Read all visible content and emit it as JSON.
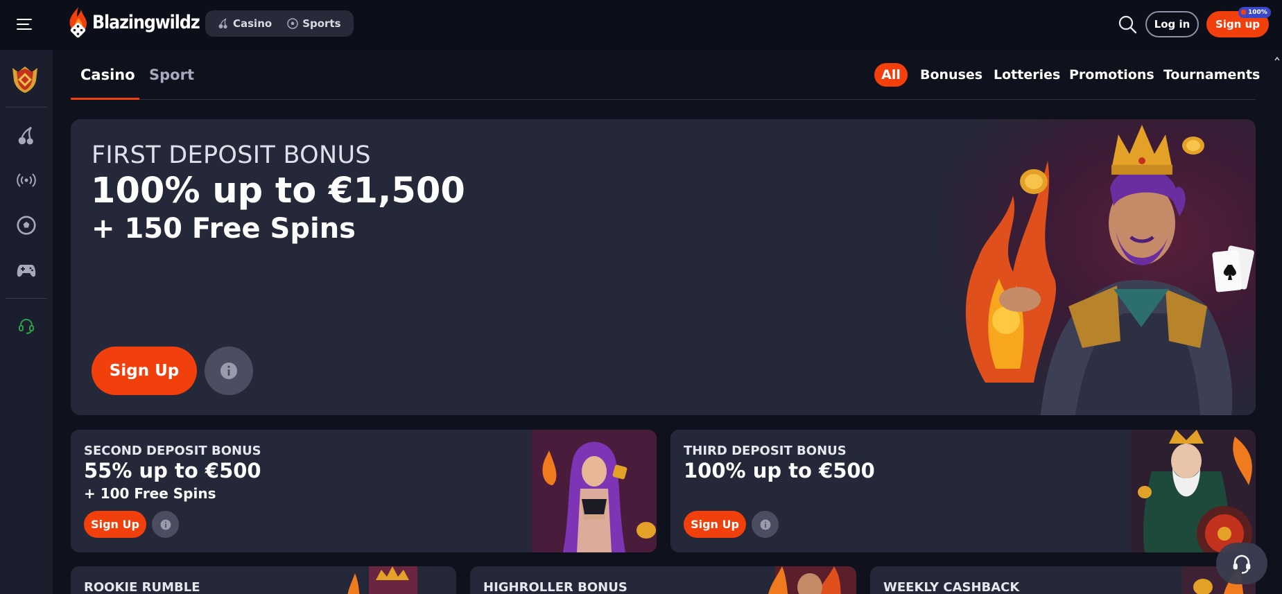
{
  "header": {
    "brand": "Blazingwildz",
    "nav": [
      {
        "label": "Casino",
        "icon": "cherries-icon"
      },
      {
        "label": "Sports",
        "icon": "soccer-ball-icon"
      }
    ],
    "login_label": "Log in",
    "signup_label": "Sign up",
    "signup_badge": "100%"
  },
  "sidebar": {
    "items": [
      {
        "icon": "vip-shield-icon"
      },
      {
        "icon": "cherries-icon"
      },
      {
        "icon": "live-broadcast-icon"
      },
      {
        "icon": "soccer-ball-icon"
      },
      {
        "icon": "gamepad-icon"
      },
      {
        "icon": "support-headset-icon"
      }
    ]
  },
  "tabs": {
    "casino": "Casino",
    "sport": "Sport",
    "filters": [
      "All",
      "Bonuses",
      "Lotteries",
      "Promotions",
      "Tournaments"
    ]
  },
  "banner": {
    "subtitle": "FIRST DEPOSIT BONUS",
    "title": "100% up to €1,500",
    "extra": "+ 150 Free Spins",
    "signup_label": "Sign Up"
  },
  "cards": [
    {
      "head": "SECOND DEPOSIT BONUS",
      "title": "55% up to €500",
      "extra": "+ 100 Free Spins",
      "signup_label": "Sign Up"
    },
    {
      "head": "THIRD DEPOSIT BONUS",
      "title": "100% up to €500",
      "extra": "",
      "signup_label": "Sign Up"
    }
  ],
  "small_cards": [
    {
      "title": "ROOKIE RUMBLE"
    },
    {
      "title": "HIGHROLLER BONUS"
    },
    {
      "title": "WEEKLY CASHBACK"
    }
  ],
  "colors": {
    "accent": "#f2400d",
    "background": "#0f121d",
    "card": "#252838",
    "sidebar": "#1b1f2d"
  }
}
